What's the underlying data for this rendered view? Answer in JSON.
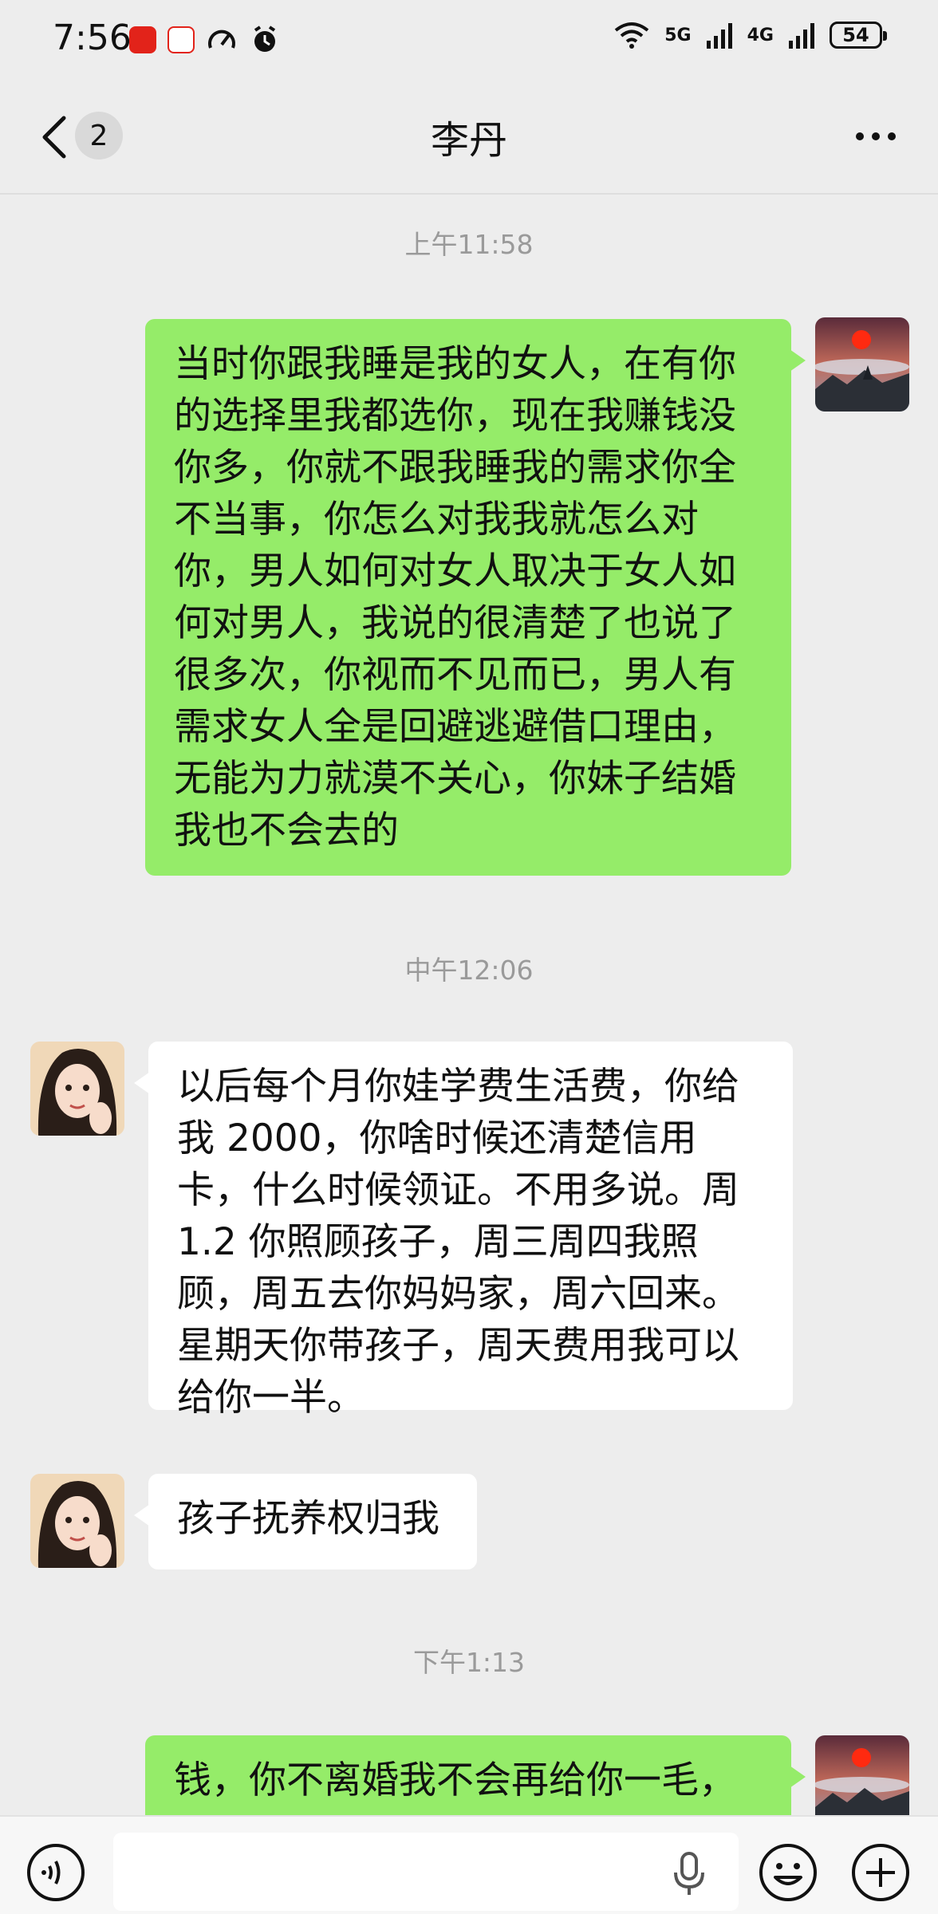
{
  "status_bar": {
    "time": "7:56",
    "network_1": "5G",
    "network_2": "4G",
    "battery": "54"
  },
  "header": {
    "unread_count": "2",
    "title": "李丹"
  },
  "messages": [
    {
      "type": "timestamp",
      "text": "上午11:58"
    },
    {
      "type": "sent",
      "text": "当时你跟我睡是我的女人，在有你的选择里我都选你，现在我赚钱没你多，你就不跟我睡我的需求你全不当事，你怎么对我我就怎么对你，男人如何对女人取决于女人如何对男人，我说的很清楚了也说了很多次，你视而不见而已，男人有需求女人全是回避逃避借口理由，无能为力就漠不关心，你妹子结婚我也不会去的"
    },
    {
      "type": "timestamp",
      "text": "中午12:06"
    },
    {
      "type": "received",
      "text": "以后每个月你娃学费生活费，你给我 2000，你啥时候还清楚信用卡，什么时候领证。不用多说。周 1.2 你照顾孩子，周三周四我照顾，周五去你妈妈家，周六回来。星期天你带孩子，周天费用我可以给你一半。"
    },
    {
      "type": "received",
      "text": "孩子抚养权归我"
    },
    {
      "type": "timestamp",
      "text": "下午1:13"
    },
    {
      "type": "sent",
      "text": "钱，你不离婚我不会再给你一毛，"
    }
  ],
  "colors": {
    "sent_bubble": "#95ec69",
    "received_bubble": "#ffffff",
    "background": "#ededed"
  }
}
